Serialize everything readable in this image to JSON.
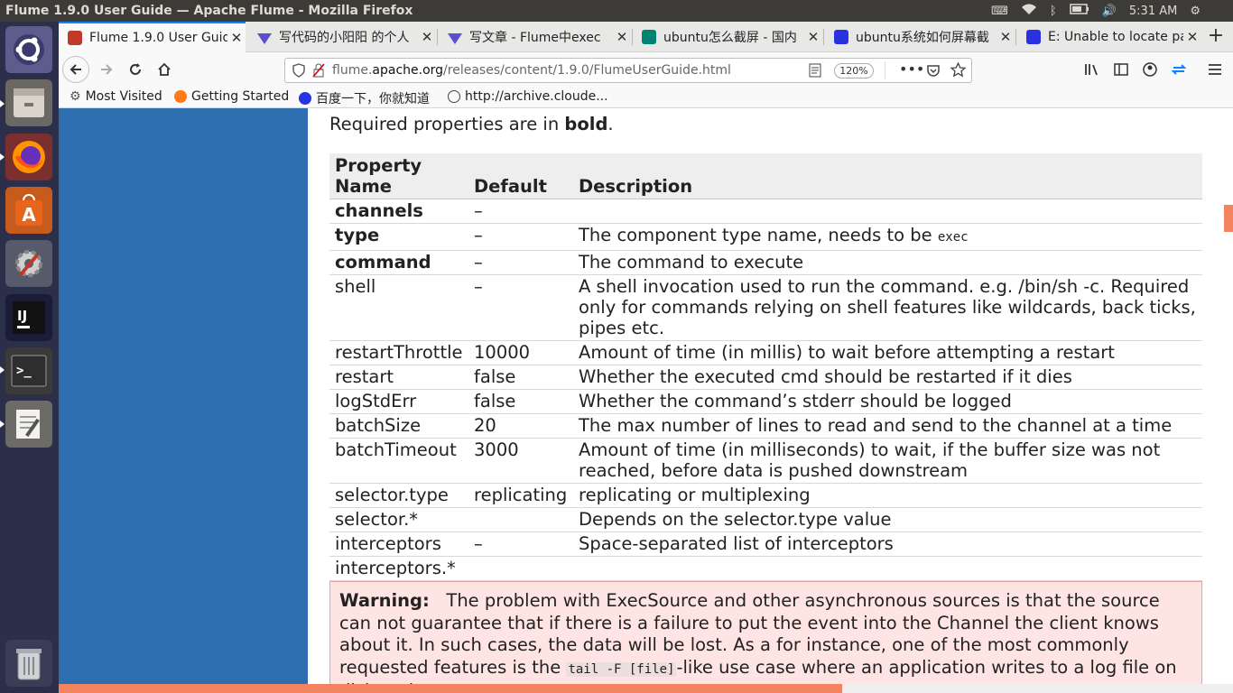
{
  "topbar": {
    "window_title": "Flume 1.9.0 User Guide — Apache Flume - Mozilla Firefox",
    "clock": "5:31 AM"
  },
  "launcher": {
    "items": [
      "ubuntu-dash",
      "files",
      "firefox",
      "software-center",
      "settings",
      "intellij",
      "terminal",
      "text-editor",
      "trash"
    ]
  },
  "tabs": [
    {
      "label": "Flume 1.9.0 User Guide",
      "close": "✕",
      "active": true
    },
    {
      "label": "写代码的小阳阳 的个人",
      "close": "✕",
      "active": false
    },
    {
      "label": "写文章 - Flume中exec",
      "close": "✕",
      "active": false
    },
    {
      "label": "ubuntu怎么截屏 - 国内",
      "close": "✕",
      "active": false
    },
    {
      "label": "ubuntu系统如何屏幕截",
      "close": "✕",
      "active": false
    },
    {
      "label": "E: Unable to locate pa",
      "close": "✕",
      "active": false
    }
  ],
  "new_tab": "+",
  "address": {
    "url_prefix": "flume.",
    "url_domain": "apache.org",
    "url_path": "/releases/content/1.9.0/FlumeUserGuide.html",
    "zoom": "120%"
  },
  "bookmarks": [
    {
      "label": "Most Visited"
    },
    {
      "label": "Getting Started"
    },
    {
      "label": "百度一下，你就知道"
    },
    {
      "label": "http://archive.cloude..."
    }
  ],
  "doc": {
    "intro_prefix": "Required properties are in ",
    "intro_bold": "bold",
    "intro_suffix": ".",
    "table_headers": [
      "Property Name",
      "Default",
      "Description"
    ],
    "rows": [
      {
        "name": "channels",
        "default": "–",
        "desc": "",
        "required": true
      },
      {
        "name": "type",
        "default": "–",
        "desc": "The component type name, needs to be ",
        "code": "exec",
        "required": true
      },
      {
        "name": "command",
        "default": "–",
        "desc": "The command to execute",
        "required": true
      },
      {
        "name": "shell",
        "default": "–",
        "desc": "A shell invocation used to run the command. e.g. /bin/sh -c. Required only for commands relying on shell features like wildcards, back ticks, pipes etc.",
        "required": false
      },
      {
        "name": "restartThrottle",
        "default": "10000",
        "desc": "Amount of time (in millis) to wait before attempting a restart",
        "required": false
      },
      {
        "name": "restart",
        "default": "false",
        "desc": "Whether the executed cmd should be restarted if it dies",
        "required": false
      },
      {
        "name": "logStdErr",
        "default": "false",
        "desc": "Whether the command’s stderr should be logged",
        "required": false
      },
      {
        "name": "batchSize",
        "default": "20",
        "desc": "The max number of lines to read and send to the channel at a time",
        "required": false
      },
      {
        "name": "batchTimeout",
        "default": "3000",
        "desc": "Amount of time (in milliseconds) to wait, if the buffer size was not reached, before data is pushed downstream",
        "required": false
      },
      {
        "name": "selector.type",
        "default": "replicating",
        "desc": "replicating or multiplexing",
        "required": false
      },
      {
        "name": "selector.*",
        "default": "",
        "desc": "Depends on the selector.type value",
        "required": false
      },
      {
        "name": "interceptors",
        "default": "–",
        "desc": "Space-separated list of interceptors",
        "required": false
      },
      {
        "name": "interceptors.*",
        "default": "",
        "desc": "",
        "required": false
      }
    ],
    "warning_title": "Warning:",
    "warning_text_1": "The problem with ExecSource and other asynchronous sources is that the source can not guarantee that if there is a failure to put the event into the Channel the client knows about it. In such cases, the data will be lost. As a for instance, one of the most commonly requested features is the ",
    "warning_code": "tail -F [file]",
    "warning_text_2": "-like use case where an application writes to a log file on disk and"
  },
  "colors": {
    "sidebar_blue": "#2d6fae",
    "warning_bg": "#ffe4e4",
    "scroll_accent": "#f4845f",
    "tab_accent": "#0a84ff",
    "launcher_bg": "#2b2f4a"
  }
}
